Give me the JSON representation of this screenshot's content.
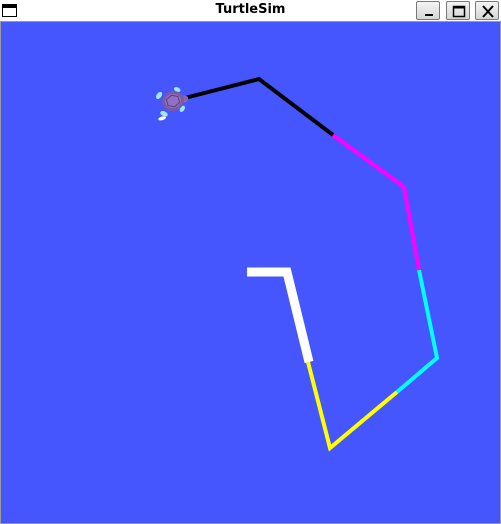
{
  "window": {
    "title": "TurtleSim",
    "controls": [
      "minimize",
      "maximize",
      "close"
    ]
  },
  "canvas": {
    "background": "#4556ff"
  },
  "trail_colors": {
    "black": "#000000",
    "magenta": "#ff00ff",
    "cyan": "#00ffff",
    "yellow": "#ffff00",
    "white": "#ffffff"
  },
  "turtle": {
    "icon": "turtle-icon"
  }
}
